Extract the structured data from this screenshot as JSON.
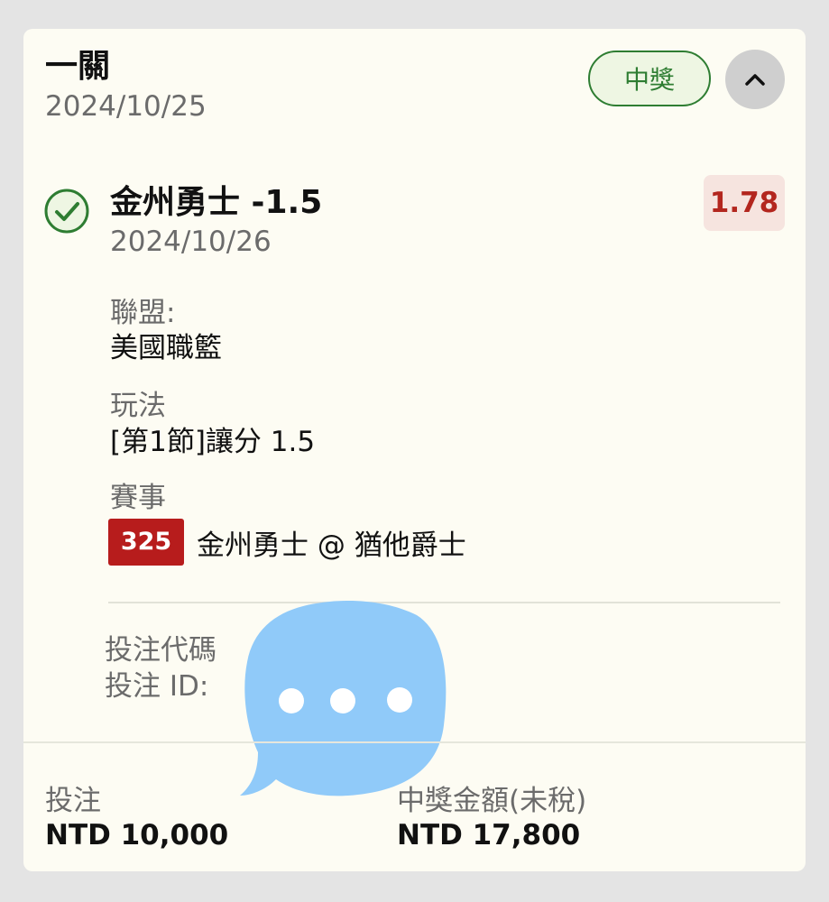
{
  "header": {
    "bet_type": "一關",
    "date": "2024/10/25",
    "status_badge": "中獎"
  },
  "selection": {
    "title": "金州勇士 -1.5",
    "date": "2024/10/26",
    "odds": "1.78",
    "status_color": "#2e7d32"
  },
  "details": {
    "league_label": "聯盟:",
    "league_value": "美國職籃",
    "play_label": "玩法",
    "play_value": "[第1節]讓分 1.5",
    "event_label": "賽事",
    "match_number": "325",
    "match_name": "金州勇士 @ 猶他爵士"
  },
  "codes": {
    "code_label": "投注代碼",
    "id_label": "投注 ID:"
  },
  "footer": {
    "stake_label": "投注",
    "stake_value": "NTD 10,000",
    "payout_label": "中獎金額(未稅)",
    "payout_value": "NTD 17,800"
  },
  "colors": {
    "win_green": "#2e7d32",
    "odds_red": "#b3261e",
    "match_red": "#b71c1c",
    "bubble_blue": "#90caf9"
  },
  "icons": {
    "check": "check-circle-icon",
    "collapse": "chevron-up-icon",
    "chat": "chat-bubble-icon"
  }
}
